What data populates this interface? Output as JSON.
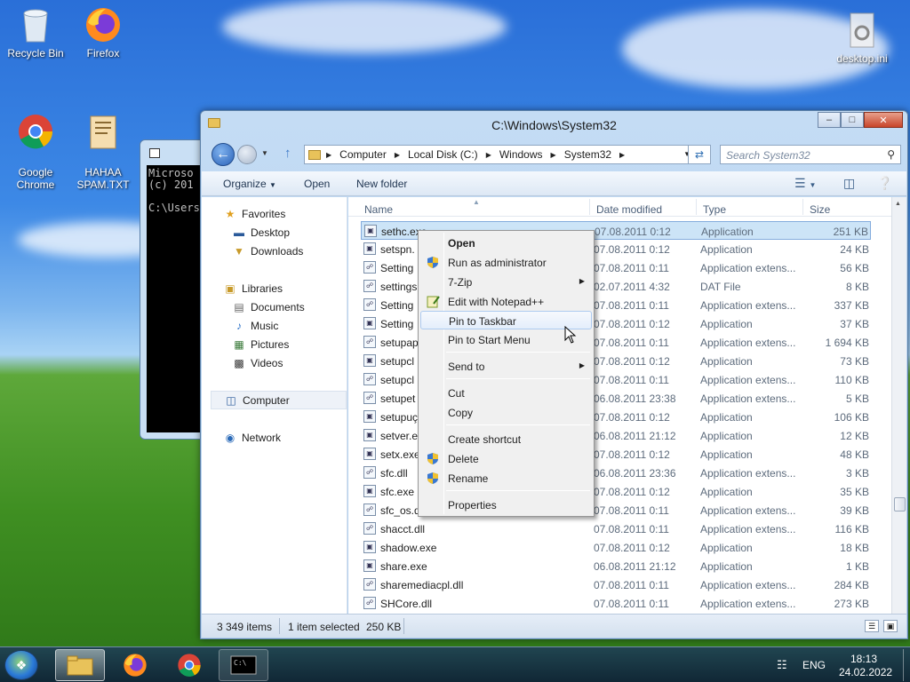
{
  "desktop": {
    "icons": [
      {
        "label": "Recycle Bin"
      },
      {
        "label": "Firefox"
      },
      {
        "label": "Google\nChrome"
      },
      {
        "label": "HAHAA\nSPAM.TXT"
      },
      {
        "label": "desktop.ini"
      }
    ]
  },
  "console": {
    "lines": "Microso\n(c) 201\n\nC:\\Users"
  },
  "explorer": {
    "title": "C:\\Windows\\System32",
    "address": [
      "Computer",
      "Local Disk (C:)",
      "Windows",
      "System32"
    ],
    "search_placeholder": "Search System32",
    "toolbar": {
      "organize": "Organize",
      "open": "Open",
      "new_folder": "New folder"
    },
    "nav": {
      "favorites": "Favorites",
      "desktop": "Desktop",
      "downloads": "Downloads",
      "libraries": "Libraries",
      "documents": "Documents",
      "music": "Music",
      "pictures": "Pictures",
      "videos": "Videos",
      "computer": "Computer",
      "network": "Network"
    },
    "columns": {
      "name": "Name",
      "date": "Date modified",
      "type": "Type",
      "size": "Size"
    },
    "files": [
      {
        "name": "sethc.exe",
        "date": "07.08.2011 0:12",
        "type": "Application",
        "size": "251 KB"
      },
      {
        "name": "setspn.",
        "date": "07.08.2011 0:12",
        "type": "Application",
        "size": "24 KB"
      },
      {
        "name": "Setting",
        "date": "07.08.2011 0:11",
        "type": "Application extens...",
        "size": "56 KB"
      },
      {
        "name": "settings",
        "date": "02.07.2011 4:32",
        "type": "DAT File",
        "size": "8 KB"
      },
      {
        "name": "Setting",
        "date": "07.08.2011 0:11",
        "type": "Application extens...",
        "size": "337 KB"
      },
      {
        "name": "Setting",
        "date": "07.08.2011 0:12",
        "type": "Application",
        "size": "37 KB"
      },
      {
        "name": "setupap",
        "date": "07.08.2011 0:11",
        "type": "Application extens...",
        "size": "1 694 KB"
      },
      {
        "name": "setupcl",
        "date": "07.08.2011 0:12",
        "type": "Application",
        "size": "73 KB"
      },
      {
        "name": "setupcl",
        "date": "07.08.2011 0:11",
        "type": "Application extens...",
        "size": "110 KB"
      },
      {
        "name": "setupet",
        "date": "06.08.2011 23:38",
        "type": "Application extens...",
        "size": "5 KB"
      },
      {
        "name": "setupuç",
        "date": "07.08.2011 0:12",
        "type": "Application",
        "size": "106 KB"
      },
      {
        "name": "setver.e",
        "date": "06.08.2011 21:12",
        "type": "Application",
        "size": "12 KB"
      },
      {
        "name": "setx.exe",
        "date": "07.08.2011 0:12",
        "type": "Application",
        "size": "48 KB"
      },
      {
        "name": "sfc.dll",
        "date": "06.08.2011 23:36",
        "type": "Application extens...",
        "size": "3 KB"
      },
      {
        "name": "sfc.exe",
        "date": "07.08.2011 0:12",
        "type": "Application",
        "size": "35 KB"
      },
      {
        "name": "sfc_os.d",
        "date": "07.08.2011 0:11",
        "type": "Application extens...",
        "size": "39 KB"
      },
      {
        "name": "shacct.dll",
        "date": "07.08.2011 0:11",
        "type": "Application extens...",
        "size": "116 KB"
      },
      {
        "name": "shadow.exe",
        "date": "07.08.2011 0:12",
        "type": "Application",
        "size": "18 KB"
      },
      {
        "name": "share.exe",
        "date": "06.08.2011 21:12",
        "type": "Application",
        "size": "1 KB"
      },
      {
        "name": "sharemediacpl.dll",
        "date": "07.08.2011 0:11",
        "type": "Application extens...",
        "size": "284 KB"
      },
      {
        "name": "SHCore.dll",
        "date": "07.08.2011 0:11",
        "type": "Application extens...",
        "size": "273 KB"
      }
    ],
    "status": {
      "count": "3 349 items",
      "selected": "1 item selected",
      "size": "250 KB"
    }
  },
  "context_menu": {
    "open": "Open",
    "run_as_admin": "Run as administrator",
    "seven_zip": "7-Zip",
    "edit_notepad": "Edit with Notepad++",
    "pin_taskbar": "Pin to Taskbar",
    "pin_start": "Pin to Start Menu",
    "send_to": "Send to",
    "cut": "Cut",
    "copy": "Copy",
    "create_shortcut": "Create shortcut",
    "delete": "Delete",
    "rename": "Rename",
    "properties": "Properties"
  },
  "taskbar": {
    "language": "ENG",
    "time": "18:13",
    "date": "24.02.2022"
  },
  "colors": {
    "accent": "#2a62b8",
    "selection": "#cce4f7"
  }
}
